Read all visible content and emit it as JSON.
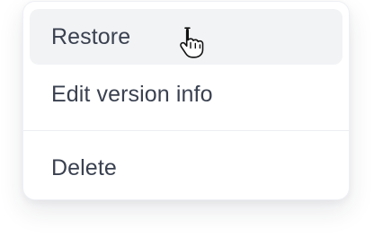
{
  "menu": {
    "items": [
      {
        "label": "Restore",
        "state": "hovered"
      },
      {
        "label": "Edit version info",
        "state": "normal"
      },
      {
        "label": "Delete",
        "state": "normal"
      }
    ]
  },
  "cursor": {
    "icon": "hand-pointer-icon"
  },
  "colors": {
    "text": "#3a4150",
    "hover_background": "#f2f3f5",
    "divider": "#eceef2"
  }
}
